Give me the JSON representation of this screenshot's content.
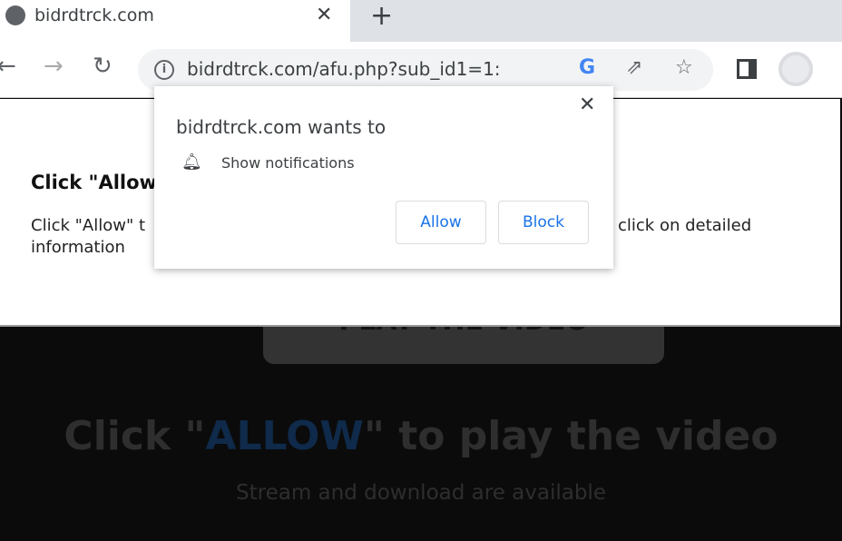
{
  "browser": {
    "tab_title": "bidrdtrck.com",
    "tab_close": "✕",
    "new_tab": "+",
    "url": "bidrdtrck.com/afu.php?sub_id1=1:",
    "icons": [
      "globe-icon",
      "back-icon",
      "forward-icon",
      "reload-icon",
      "info-icon",
      "google-icon",
      "share-icon",
      "star-icon",
      "side-panel-icon",
      "profile-avatar"
    ]
  },
  "popup": {
    "title": "bidrdtrck.com wants to",
    "permission": "Show notifications",
    "allow": "Allow",
    "block": "Block",
    "close": "✕"
  },
  "page": {
    "heading": "Click \"Allow",
    "line1_left": "Click \"Allow\" t",
    "line1_right": "click on detailed",
    "line2": "information",
    "play_button": "PLAY THE VIDEO",
    "headline_pre": "Click \"",
    "headline_highlight": "ALLOW",
    "headline_post": "\" to play the video",
    "subline": "Stream and download are available"
  },
  "colors": {
    "accent": "#1a73e8",
    "highlight": "#0f2a4a",
    "background": "#0b0b0b"
  }
}
